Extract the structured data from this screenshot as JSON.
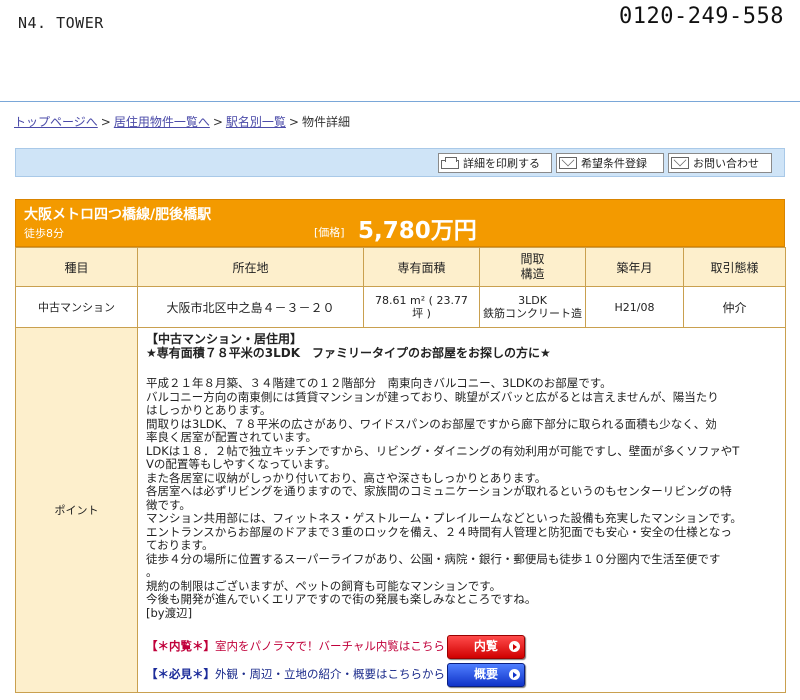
{
  "header": {
    "brand": "N4. TOWER",
    "phone": "0120-249-558"
  },
  "breadcrumb": {
    "items": [
      "トップページへ",
      "居住用物件一覧へ",
      "駅名別一覧",
      "物件詳細"
    ],
    "separator": ">"
  },
  "toolbar": {
    "print_label": "詳細を印刷する",
    "register_label": "希望条件登録",
    "contact_label": "お問い合わせ"
  },
  "property": {
    "station": "大阪メトロ四つ橋線/肥後橋駅",
    "walk": "徒歩8分",
    "price_label": "[価格]",
    "price": "5,780万円"
  },
  "table": {
    "headers": [
      "種目",
      "所在地",
      "専有面積",
      "間取\n構造",
      "築年月",
      "取引態様"
    ],
    "row": [
      "中古マンション",
      "大阪市北区中之島４－３－２０",
      "78.61 m² ( 23.77\n坪 )",
      "3LDK\n鉄筋コンクリート造",
      "H21/08",
      "仲介"
    ]
  },
  "point": {
    "label": "ポイント",
    "title_line1": "【中古マンション・居住用】",
    "title_line2": "★専有面積７８平米の3LDK　ファミリータイプのお部屋をお探しの方に★",
    "body_lines": [
      "平成２１年８月築、３４階建ての１２階部分　南東向きバルコニー、3LDKのお部屋です。",
      "バルコニー方向の南東側には賃貸マンションが建っており、眺望がズバッと広がるとは言えませんが、陽当たり",
      "はしっかりとあります。",
      "間取りは3LDK、７８平米の広さがあり、ワイドスパンのお部屋ですから廊下部分に取られる面積も少なく、効",
      "率良く居室が配置されています。",
      "LDKは１８．２帖で独立キッチンですから、リビング・ダイニングの有効利用が可能ですし、壁面が多くソファやT",
      "Vの配置等もしやすくなっています。",
      "また各居室に収納がしっかり付いており、高さや深さもしっかりとあります。",
      "各居室へは必ずリビングを通りますので、家族間のコミュニケーションが取れるというのもセンターリビングの特",
      "徴です。",
      "マンション共用部には、フィットネス・ゲストルーム・プレイルームなどといった設備も充実したマンションです。",
      "エントランスからお部屋のドアまで３重のロックを備え、２４時間有人管理と防犯面でも安心・安全の仕様となっ",
      "ております。",
      "徒歩４分の場所に位置するスーパーライフがあり、公園・病院・銀行・郵便局も徒歩１０分圏内で生活至便です",
      "。",
      "規約の制限はございますが、ペットの飼育も可能なマンションです。",
      "今後も開発が進んでいくエリアですので街の発展も楽しみなところですね。",
      "[by渡辺]"
    ],
    "tour_tag": "【＊内覧＊】",
    "tour_text": "室内をパノラマで！バーチャル内覧はこちら",
    "tour_button": "内覧",
    "see_tag": "【＊必見＊】",
    "see_text": "外観・周辺・立地の紹介・概要はこちらから",
    "see_button": "概要"
  },
  "colors": {
    "accent_orange": "#f39a00",
    "toolbar_blue": "#cfe4f7",
    "header_cell": "#fdefcc",
    "red_button": "#d00000",
    "blue_button": "#1033c8"
  }
}
